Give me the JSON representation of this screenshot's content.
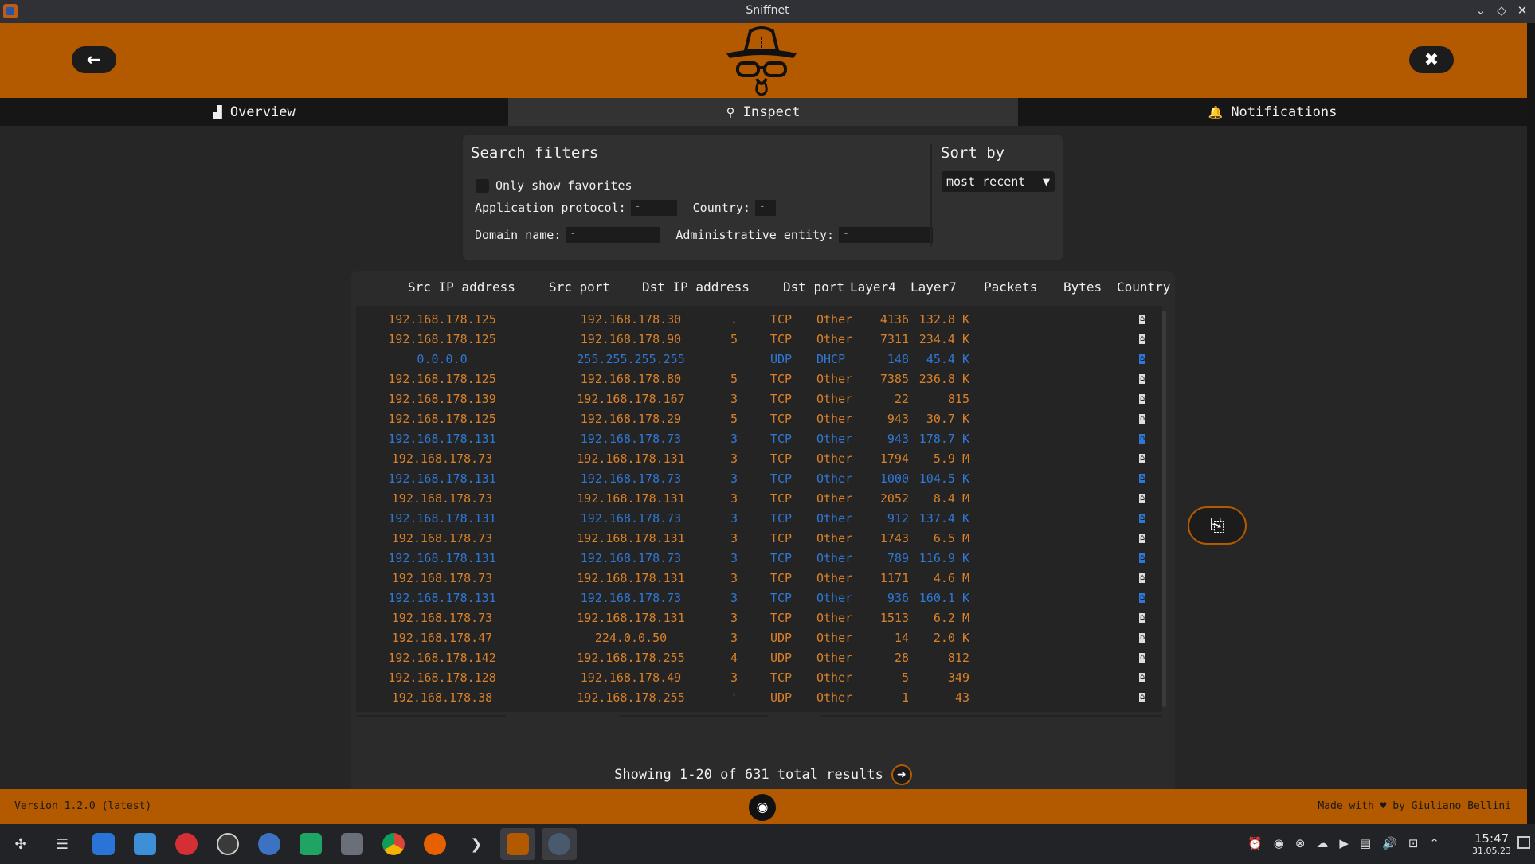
{
  "window": {
    "title": "Sniffnet",
    "minimize": "⌄",
    "maximize": "◇",
    "close": "✕"
  },
  "header": {
    "back_icon": "←",
    "settings_icon": "✖"
  },
  "tabs": [
    {
      "label": "Overview",
      "icon": "▟"
    },
    {
      "label": "Inspect",
      "icon": "⚲"
    },
    {
      "label": "Notifications",
      "icon": "🔔"
    }
  ],
  "filters": {
    "title": "Search filters",
    "favorites_label": "Only show favorites",
    "app_protocol_label": "Application protocol:",
    "app_protocol_value": "-",
    "country_label": "Country:",
    "country_value": "-",
    "domain_label": "Domain name:",
    "domain_value": "-",
    "entity_label": "Administrative entity:",
    "entity_value": "-"
  },
  "sort": {
    "title": "Sort by",
    "value": "most recent",
    "arrow": "▼"
  },
  "table": {
    "headers": [
      "Src IP address",
      "Src port",
      "Dst IP address",
      "Dst port",
      "Layer4",
      "Layer7",
      "Packets",
      "Bytes",
      "Country"
    ],
    "rows": [
      {
        "color": "orange",
        "src": "192.168.178.125",
        "sport": "",
        "dst": "192.168.178.30",
        "dport": ".",
        "l4": "TCP",
        "l7": "Other",
        "packets": "4136",
        "bytes": "132.8 K"
      },
      {
        "color": "orange",
        "src": "192.168.178.125",
        "sport": "",
        "dst": "192.168.178.90",
        "dport": "5",
        "l4": "TCP",
        "l7": "Other",
        "packets": "7311",
        "bytes": "234.4 K"
      },
      {
        "color": "blue",
        "src": "0.0.0.0",
        "sport": "",
        "dst": "255.255.255.255",
        "dport": "",
        "l4": "UDP",
        "l7": "DHCP",
        "packets": "148",
        "bytes": "45.4 K"
      },
      {
        "color": "orange",
        "src": "192.168.178.125",
        "sport": "",
        "dst": "192.168.178.80",
        "dport": "5",
        "l4": "TCP",
        "l7": "Other",
        "packets": "7385",
        "bytes": "236.8 K"
      },
      {
        "color": "orange",
        "src": "192.168.178.139",
        "sport": "",
        "dst": "192.168.178.167",
        "dport": "3",
        "l4": "TCP",
        "l7": "Other",
        "packets": "22",
        "bytes": "815"
      },
      {
        "color": "orange",
        "src": "192.168.178.125",
        "sport": "",
        "dst": "192.168.178.29",
        "dport": "5",
        "l4": "TCP",
        "l7": "Other",
        "packets": "943",
        "bytes": "30.7 K"
      },
      {
        "color": "blue",
        "src": "192.168.178.131",
        "sport": "",
        "dst": "192.168.178.73",
        "dport": "3",
        "l4": "TCP",
        "l7": "Other",
        "packets": "943",
        "bytes": "178.7 K"
      },
      {
        "color": "orange",
        "src": "192.168.178.73",
        "sport": "",
        "dst": "192.168.178.131",
        "dport": "3",
        "l4": "TCP",
        "l7": "Other",
        "packets": "1794",
        "bytes": "5.9 M"
      },
      {
        "color": "blue",
        "src": "192.168.178.131",
        "sport": "",
        "dst": "192.168.178.73",
        "dport": "3",
        "l4": "TCP",
        "l7": "Other",
        "packets": "1000",
        "bytes": "104.5 K"
      },
      {
        "color": "orange",
        "src": "192.168.178.73",
        "sport": "",
        "dst": "192.168.178.131",
        "dport": "3",
        "l4": "TCP",
        "l7": "Other",
        "packets": "2052",
        "bytes": "8.4 M"
      },
      {
        "color": "blue",
        "src": "192.168.178.131",
        "sport": "",
        "dst": "192.168.178.73",
        "dport": "3",
        "l4": "TCP",
        "l7": "Other",
        "packets": "912",
        "bytes": "137.4 K"
      },
      {
        "color": "orange",
        "src": "192.168.178.73",
        "sport": "",
        "dst": "192.168.178.131",
        "dport": "3",
        "l4": "TCP",
        "l7": "Other",
        "packets": "1743",
        "bytes": "6.5 M"
      },
      {
        "color": "blue",
        "src": "192.168.178.131",
        "sport": "",
        "dst": "192.168.178.73",
        "dport": "3",
        "l4": "TCP",
        "l7": "Other",
        "packets": "789",
        "bytes": "116.9 K"
      },
      {
        "color": "orange",
        "src": "192.168.178.73",
        "sport": "",
        "dst": "192.168.178.131",
        "dport": "3",
        "l4": "TCP",
        "l7": "Other",
        "packets": "1171",
        "bytes": "4.6 M"
      },
      {
        "color": "blue",
        "src": "192.168.178.131",
        "sport": "",
        "dst": "192.168.178.73",
        "dport": "3",
        "l4": "TCP",
        "l7": "Other",
        "packets": "936",
        "bytes": "160.1 K"
      },
      {
        "color": "orange",
        "src": "192.168.178.73",
        "sport": "",
        "dst": "192.168.178.131",
        "dport": "3",
        "l4": "TCP",
        "l7": "Other",
        "packets": "1513",
        "bytes": "6.2 M"
      },
      {
        "color": "orange",
        "src": "192.168.178.47",
        "sport": "",
        "dst": "224.0.0.50",
        "dport": "3",
        "l4": "UDP",
        "l7": "Other",
        "packets": "14",
        "bytes": "2.0 K"
      },
      {
        "color": "orange",
        "src": "192.168.178.142",
        "sport": "",
        "dst": "192.168.178.255",
        "dport": "4",
        "l4": "UDP",
        "l7": "Other",
        "packets": "28",
        "bytes": "812"
      },
      {
        "color": "orange",
        "src": "192.168.178.128",
        "sport": "",
        "dst": "192.168.178.49",
        "dport": "3",
        "l4": "TCP",
        "l7": "Other",
        "packets": "5",
        "bytes": "349"
      },
      {
        "color": "orange",
        "src": "192.168.178.38",
        "sport": "",
        "dst": "192.168.178.255",
        "dport": "'",
        "l4": "UDP",
        "l7": "Other",
        "packets": "1",
        "bytes": "43"
      }
    ],
    "country_icon": "⌂"
  },
  "pager": {
    "text": "Showing 1-20 of 631 total results",
    "next_icon": "➜"
  },
  "export_icon": "⎘",
  "footer": {
    "version": "Version 1.2.0 (latest)",
    "made_with": "Made with ♥ by Giuliano Bellini",
    "github_icon": "◉"
  },
  "taskbar": {
    "time": "15:47",
    "date": "31.05.23"
  },
  "colors": {
    "accent": "#b35900",
    "incoming": "#2f78d6",
    "outgoing": "#d9812a"
  }
}
